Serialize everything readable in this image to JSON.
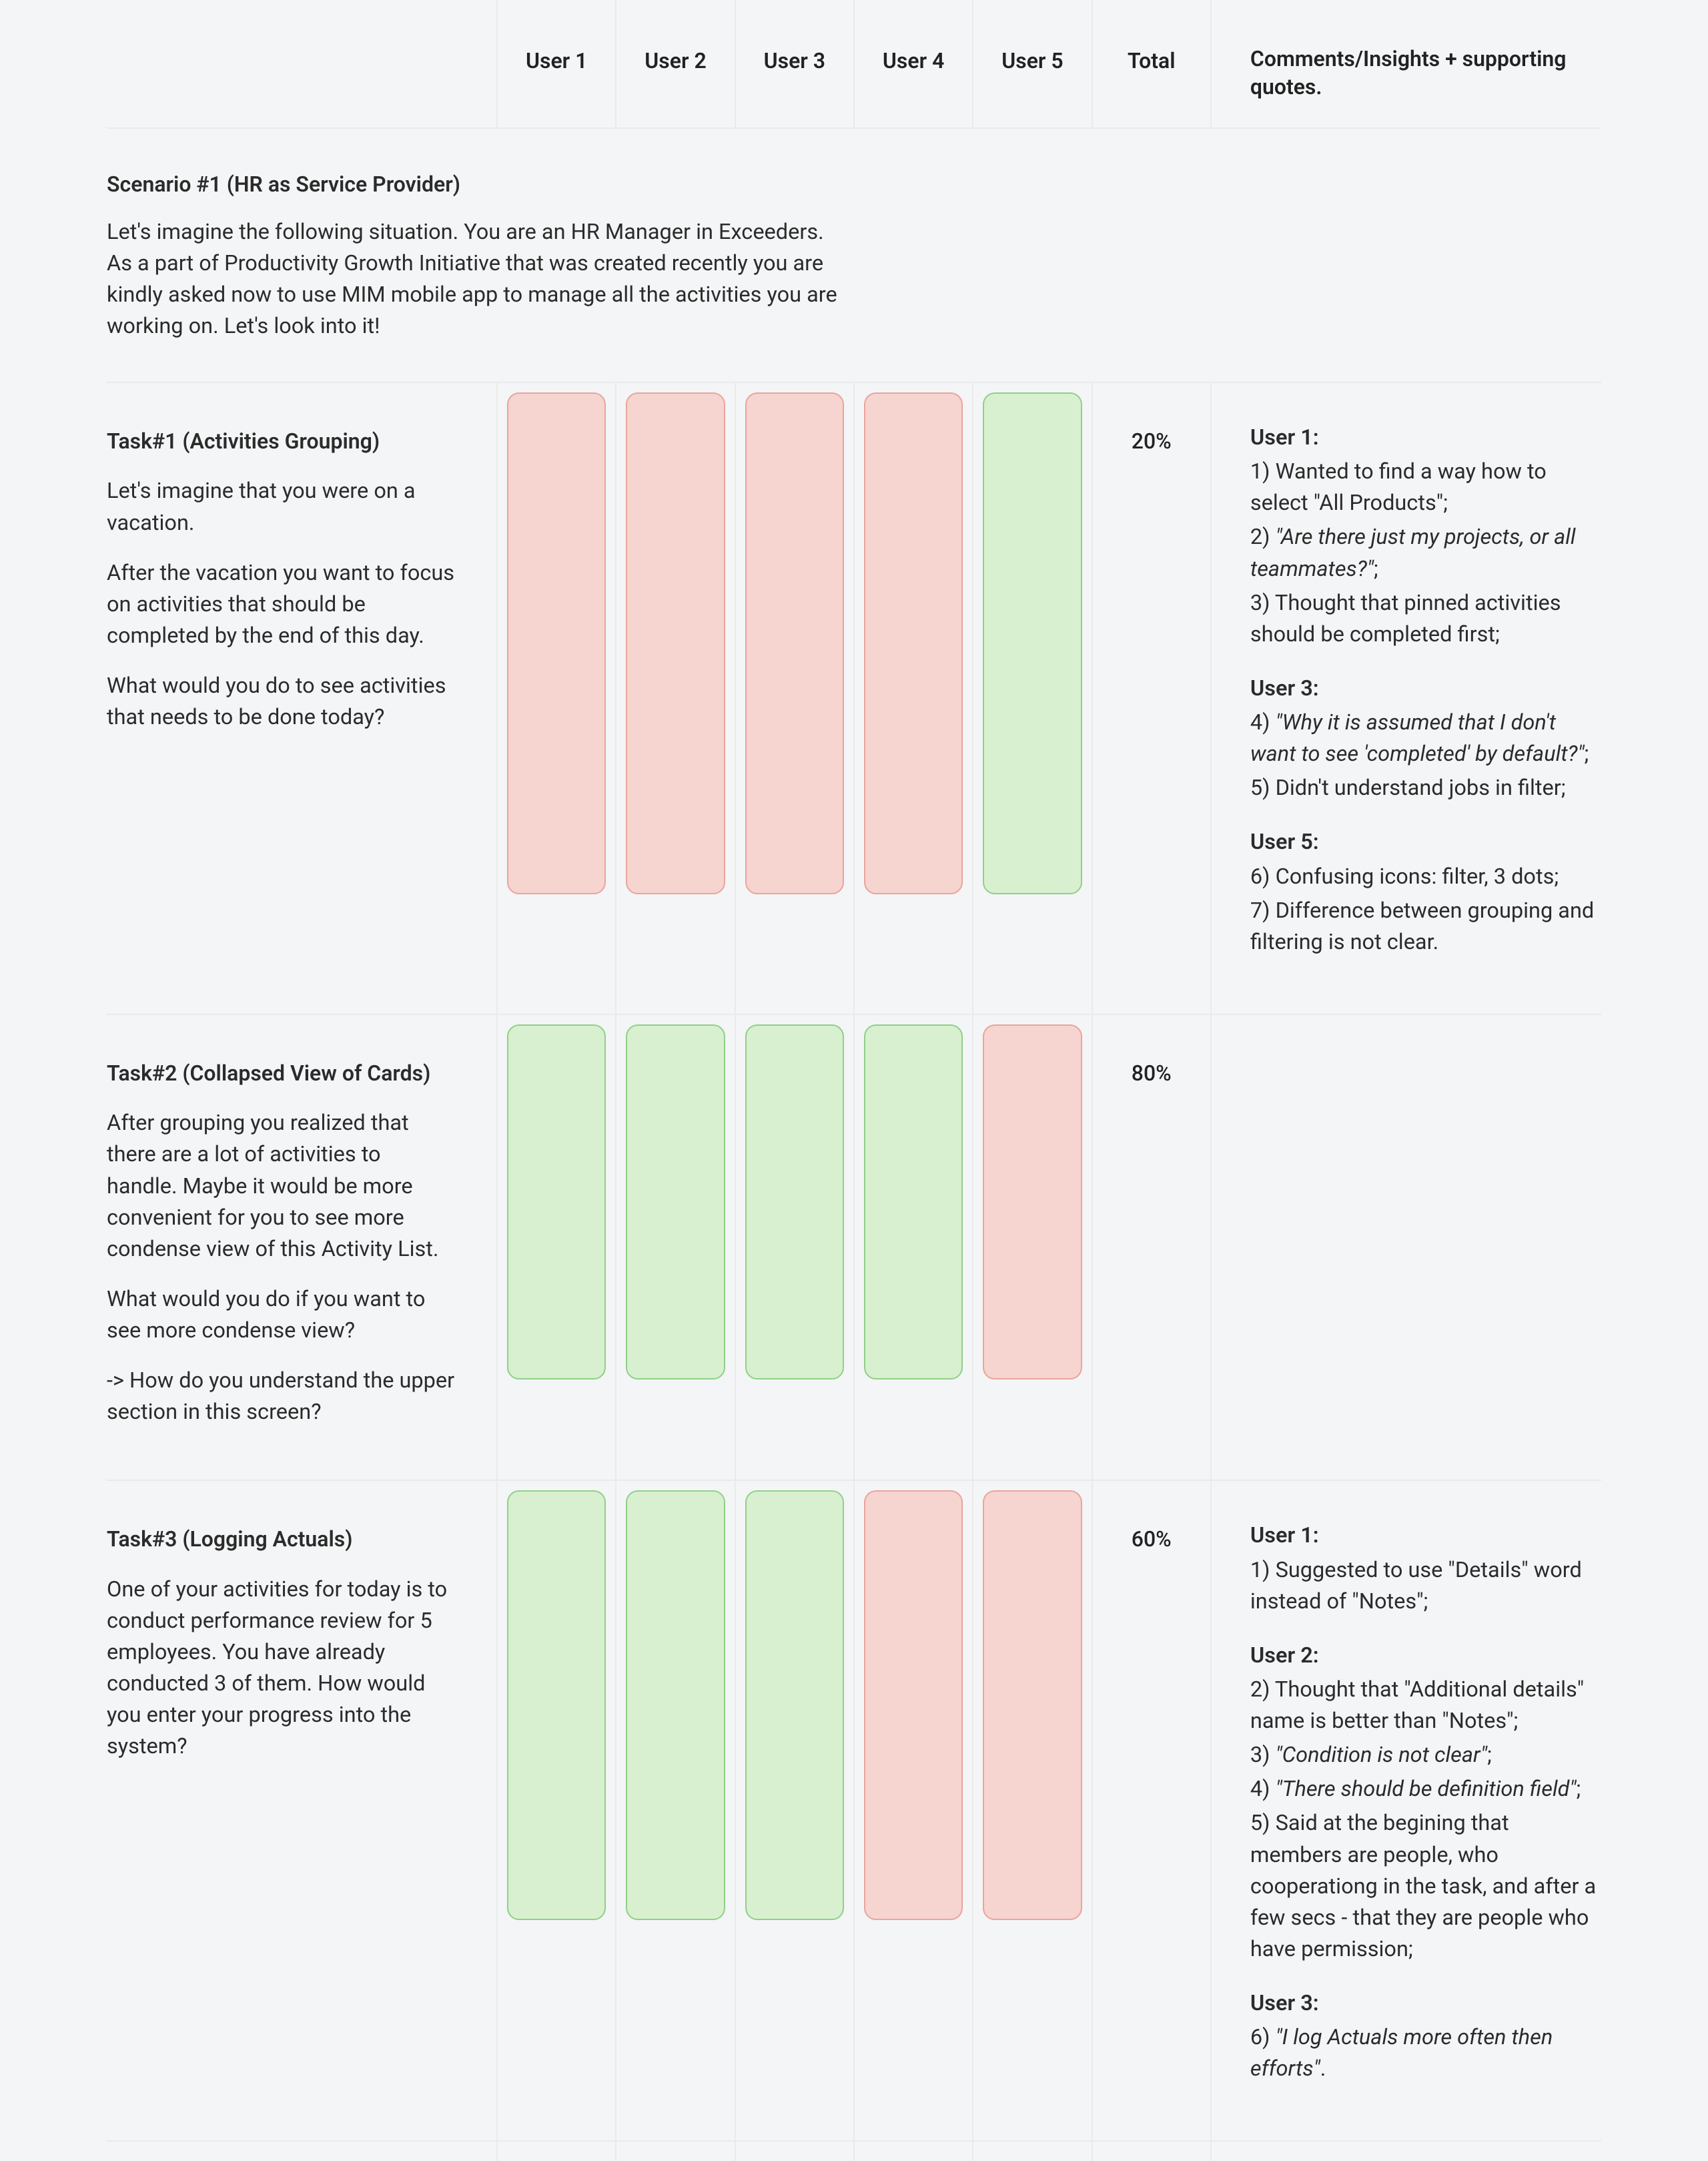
{
  "columns": {
    "task": "",
    "users": [
      "User 1",
      "User 2",
      "User 3",
      "User 4",
      "User 5"
    ],
    "total": "Total",
    "comments": "Comments/Insights + supporting quotes."
  },
  "scenario": {
    "title": "Scenario #1 (HR as Service Provider)",
    "description": "Let's imagine the following situation. You are an HR Manager in Exceeders. As a part of Productivity Growth Initiative that was created recently you are kindly asked now to use MIM mobile app to manage all the activities you are working on. Let's look into it!"
  },
  "tasks": [
    {
      "id": "task1",
      "title": "Task#1 (Activities Grouping)",
      "paragraphs": [
        "Let's imagine that you were on a vacation.",
        "After the vacation you want to focus on activities that should be completed by the end of this day.",
        "What would you do to see activities that needs to be done today?"
      ],
      "results": [
        "fail",
        "fail",
        "fail",
        "fail",
        "success"
      ],
      "total": "20%",
      "comments": [
        {
          "user": "User 1:",
          "items": [
            {
              "n": "1)",
              "text": "Wanted to find a way how to select \"All Products\";",
              "quote": false
            },
            {
              "n": "2)",
              "text": "\"Are there just my projects, or all teammates?\"",
              "suffix": ";",
              "quote": true
            },
            {
              "n": "3)",
              "text": "Thought that pinned activities should be completed first;",
              "quote": false
            }
          ]
        },
        {
          "user": "User 3:",
          "items": [
            {
              "n": "4)",
              "text": "\"Why it is assumed that I don't want to see 'completed' by default?\"",
              "suffix": ";",
              "quote": true
            },
            {
              "n": "5)",
              "text": "Didn't understand jobs in filter;",
              "quote": false
            }
          ]
        },
        {
          "user": "User 5:",
          "items": [
            {
              "n": "6)",
              "text": "Confusing icons: filter, 3 dots;",
              "quote": false
            },
            {
              "n": "7)",
              "text": "Difference between grouping and filtering is not clear.",
              "quote": false
            }
          ]
        }
      ]
    },
    {
      "id": "task2",
      "title": "Task#2 (Collapsed View of Cards)",
      "paragraphs": [
        "After grouping you realized that there are a lot of activities to handle. Maybe it would be more convenient for you to see more condense view of this Activity List.",
        "What would you do if you want to see more condense view?",
        "-> How do you understand the upper section in this screen?"
      ],
      "results": [
        "success",
        "success",
        "success",
        "success",
        "fail"
      ],
      "total": "80%",
      "comments": []
    },
    {
      "id": "task3",
      "title": "Task#3 (Logging Actuals)",
      "paragraphs": [
        "One of your activities for today is to conduct performance review for 5 employees. You have already conducted 3 of them. How would you enter your progress into the system?"
      ],
      "results": [
        "success",
        "success",
        "success",
        "fail",
        "fail"
      ],
      "total": "60%",
      "comments": [
        {
          "user": "User 1:",
          "items": [
            {
              "n": "1)",
              "text": "Suggested to use \"Details\" word instead of \"Notes\";",
              "quote": false
            }
          ]
        },
        {
          "user": "User 2:",
          "items": [
            {
              "n": "2)",
              "text": "Thought that \"Additional details\" name is better than \"Notes\";",
              "quote": false
            },
            {
              "n": "3)",
              "text": "\"Condition is not clear\"",
              "suffix": ";",
              "quote": true
            },
            {
              "n": "4)",
              "text": "\"There should be definition field\"",
              "suffix": ";",
              "quote": true
            },
            {
              "n": "5)",
              "text": "Said at the begining that members are people, who cooperationg in the task, and after a few secs - that they are people who have permission;",
              "quote": false
            }
          ]
        },
        {
          "user": "User 3:",
          "items": [
            {
              "n": "6)",
              "text": "\"I log Actuals more often then efforts\"",
              "suffix": ".",
              "quote": true
            }
          ]
        }
      ]
    }
  ]
}
